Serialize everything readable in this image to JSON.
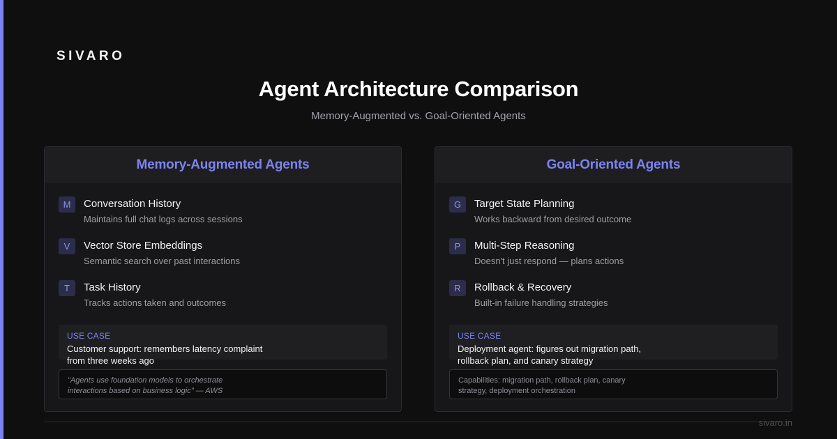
{
  "brand": "SIVARO",
  "title": "Agent Architecture Comparison",
  "subtitle": "Memory-Augmented vs. Goal-Oriented Agents",
  "accent_color": "#7c83f0",
  "cards": [
    {
      "heading": "Memory-Augmented Agents",
      "features": [
        {
          "badge": "M",
          "title": "Conversation History",
          "desc": "Maintains full chat logs across sessions"
        },
        {
          "badge": "V",
          "title": "Vector Store Embeddings",
          "desc": "Semantic search over past interactions"
        },
        {
          "badge": "T",
          "title": "Task History",
          "desc": "Tracks actions taken and outcomes"
        }
      ],
      "usecase_label": "USE CASE",
      "usecase_text": "Customer support: remembers latency complaint from three weeks ago",
      "note": "\"Agents use foundation models to orchestrate interactions based on business logic\" — AWS"
    },
    {
      "heading": "Goal-Oriented Agents",
      "features": [
        {
          "badge": "G",
          "title": "Target State Planning",
          "desc": "Works backward from desired outcome"
        },
        {
          "badge": "P",
          "title": "Multi-Step Reasoning",
          "desc": "Doesn't just respond — plans actions"
        },
        {
          "badge": "R",
          "title": "Rollback & Recovery",
          "desc": "Built-in failure handling strategies"
        }
      ],
      "usecase_label": "USE CASE",
      "usecase_text": "Deployment agent: figures out migration path, rollback plan, and canary strategy",
      "note": "Capabilities: migration path, rollback plan, canary strategy, deployment orchestration"
    }
  ],
  "footer_url": "sivaro.in"
}
